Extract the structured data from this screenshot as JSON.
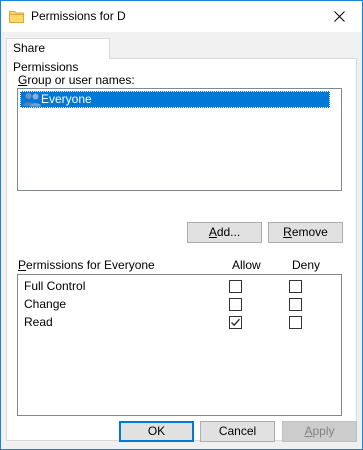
{
  "window": {
    "title": "Permissions for D"
  },
  "tabs": [
    {
      "label": "Share Permissions",
      "active": true
    }
  ],
  "group_section": {
    "label_prefix": "",
    "label_accel": "G",
    "label_rest": "roup or user names:",
    "users": [
      {
        "name": "Everyone",
        "icon": "users-icon",
        "selected": true
      }
    ]
  },
  "buttons": {
    "add": {
      "prefix": "",
      "accel": "A",
      "rest": "dd..."
    },
    "remove": {
      "prefix": "",
      "accel": "R",
      "rest": "emove"
    }
  },
  "permissions": {
    "label_accel": "P",
    "label_rest": "ermissions for Everyone",
    "allow_header": "Allow",
    "deny_header": "Deny",
    "rows": [
      {
        "name": "Full Control",
        "allow": false,
        "deny": false
      },
      {
        "name": "Change",
        "allow": false,
        "deny": false
      },
      {
        "name": "Read",
        "allow": true,
        "deny": false
      }
    ]
  },
  "footer": {
    "ok": "OK",
    "cancel": "Cancel",
    "apply_accel": "A",
    "apply_rest": "pply",
    "apply_enabled": false
  },
  "colors": {
    "selection": "#0078d7",
    "window_border": "#1883d7",
    "dialog_bg": "#f0f0f0",
    "folder_icon": "#e8b94a"
  }
}
